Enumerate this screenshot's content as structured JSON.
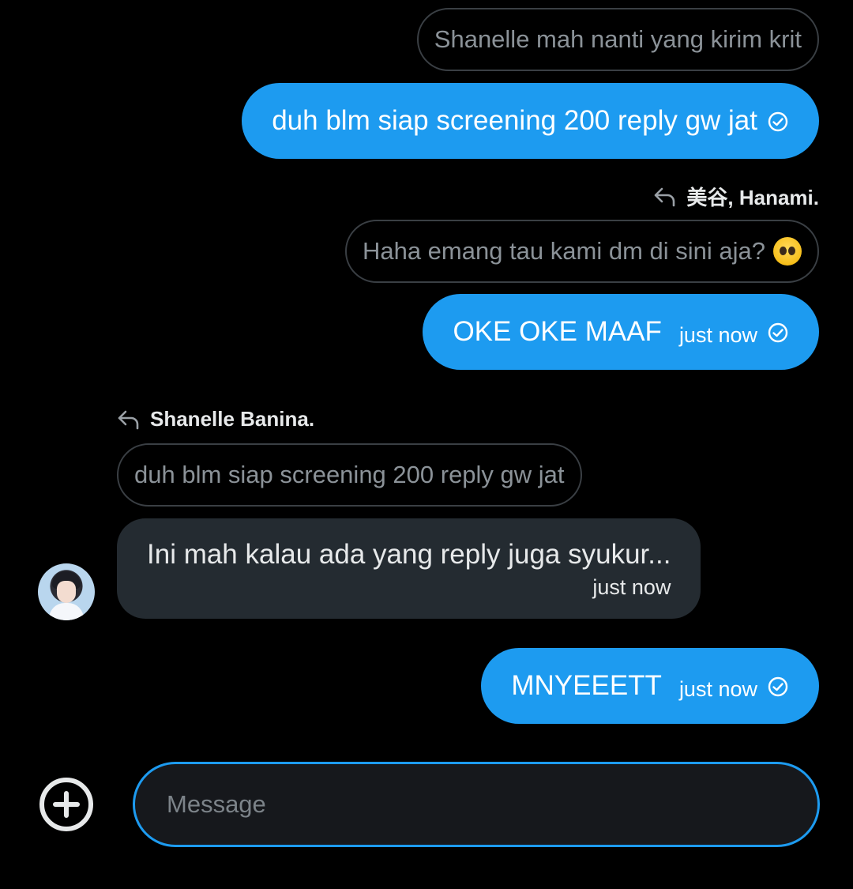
{
  "messages": {
    "m1_quoted": "Shanelle mah nanti yang kirim krit",
    "m1_text": "duh blm siap screening 200 reply gw jat",
    "m2_reply_to": "美谷, Hanami.",
    "m2_quoted": "Haha emang tau kami dm di sini aja?",
    "m2_quoted_emoji": "pleading-face",
    "m2_text": "OKE OKE MAAF",
    "m2_time": "just now",
    "m3_reply_to": "Shanelle Banina.",
    "m3_quoted": "duh blm siap screening 200 reply gw jat",
    "m3_text": "Ini mah kalau ada yang reply juga syukur...",
    "m3_time": "just now",
    "m4_text": "MNYEEETT",
    "m4_time": "just now"
  },
  "composer": {
    "placeholder": "Message"
  },
  "colors": {
    "accent": "#1d9bf0",
    "incoming_bubble": "#242b31",
    "background": "#000000"
  },
  "icons": {
    "sent": "check-circle-icon",
    "reply": "reply-arrow-icon",
    "add": "plus-circle-icon"
  }
}
